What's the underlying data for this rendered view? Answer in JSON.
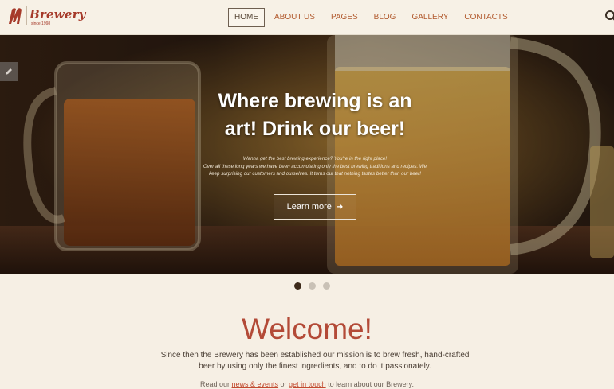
{
  "brand": {
    "name": "Brewery",
    "since": "since 1998"
  },
  "nav": {
    "items": [
      {
        "label": "HOME",
        "active": true
      },
      {
        "label": "ABOUT US",
        "active": false
      },
      {
        "label": "PAGES",
        "active": false
      },
      {
        "label": "BLOG",
        "active": false
      },
      {
        "label": "GALLERY",
        "active": false
      },
      {
        "label": "CONTACTS",
        "active": false
      }
    ]
  },
  "hero": {
    "title_line1": "Where brewing is an",
    "title_line2": "art! Drink our beer!",
    "text_line1": "Wanna get the best brewing experience? You're in the right place!",
    "text_line2": "Over all these long years we have been accumulating only the best brewing traditions and recipes. We",
    "text_line3": "keep surprising our customers and ourselves. It turns out that nothing tastes better than our beer!",
    "button_label": "Learn more",
    "button_icon": "arrow-right-icon"
  },
  "slider": {
    "total": 3,
    "active_index": 0
  },
  "welcome": {
    "title": "Welcome!",
    "text_line1": "Since then the Brewery has been established our mission is to brew fresh, hand-crafted",
    "text_line2": "beer by using only the finest ingredients, and to do it passionately.",
    "readon_pre": "Read our ",
    "readon_link1": "news & events",
    "readon_mid": " or ",
    "readon_link2": "get in touch",
    "readon_post": " to learn about our Brewery."
  },
  "colors": {
    "accent": "#b34a37",
    "link": "#c24a2f",
    "background": "#f6efe4",
    "nav_text": "#b25b2f"
  }
}
